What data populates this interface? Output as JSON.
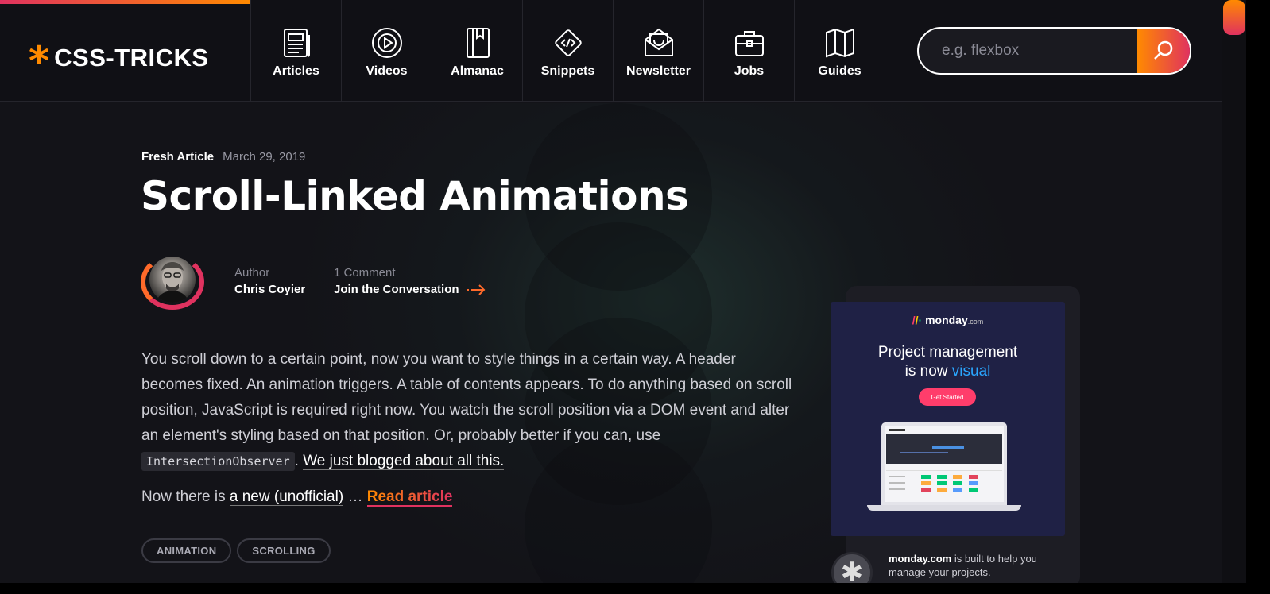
{
  "header": {
    "logo_text": "CSS-TRICKS",
    "logo_mark": "*",
    "nav": [
      {
        "label": "Articles",
        "icon": "newspaper-icon"
      },
      {
        "label": "Videos",
        "icon": "play-circle-icon"
      },
      {
        "label": "Almanac",
        "icon": "book-icon"
      },
      {
        "label": "Snippets",
        "icon": "code-diamond-icon"
      },
      {
        "label": "Newsletter",
        "icon": "mail-icon"
      },
      {
        "label": "Jobs",
        "icon": "briefcase-icon"
      },
      {
        "label": "Guides",
        "icon": "map-icon"
      }
    ],
    "search": {
      "placeholder": "e.g. flexbox",
      "value": "",
      "icon": "search-icon"
    }
  },
  "article": {
    "kicker": "Fresh Article",
    "date": "March 29, 2019",
    "title": "Scroll-Linked Animations",
    "author_label": "Author",
    "author_name": "Chris Coyier",
    "comments_label": "1 Comment",
    "comments_link": "Join the Conversation",
    "body_1": "You scroll down to a certain point, now you want to style things in a certain way. A header becomes fixed. An animation triggers. A table of contents appears. To do anything based on scroll position, JavaScript is required right now. You watch the scroll position via a DOM event and alter an element's styling based on that position. Or, probably better if you can, use",
    "code": "IntersectionObserver",
    "sep": ".",
    "link_1": "We just blogged about all this.",
    "para2_prefix": "Now there is",
    "link_2": "a new (unofficial)",
    "ellipsis": "…",
    "read_more": "Read article",
    "tags": [
      "ANIMATION",
      "SCROLLING"
    ]
  },
  "ad": {
    "brand": "monday",
    "brand_suffix": ".com",
    "headline_1": "Project management",
    "headline_2": "is now",
    "headline_highlight": "visual",
    "cta": "Get Started",
    "desc_brand": "monday.com",
    "desc_text": "is built to help you manage your projects."
  },
  "colors": {
    "accent_orange": "#ff8a00",
    "accent_pink": "#e0325f",
    "background": "#131318",
    "ad_blue": "#2aa6ff"
  }
}
